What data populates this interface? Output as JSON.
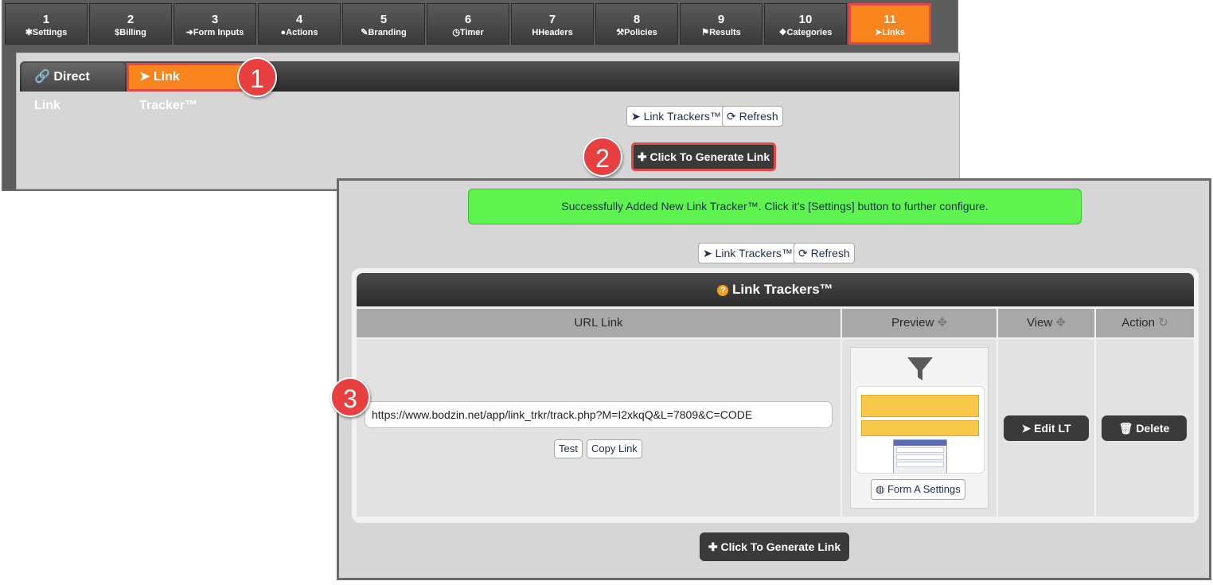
{
  "steps": [
    {
      "num": "1",
      "label": "Settings",
      "icon": "gear-icon"
    },
    {
      "num": "2",
      "label": "Billing",
      "icon": "dollar-icon"
    },
    {
      "num": "3",
      "label": "Form Inputs",
      "icon": "sign-in-icon"
    },
    {
      "num": "4",
      "label": "Actions",
      "icon": "user-icon"
    },
    {
      "num": "5",
      "label": "Branding",
      "icon": "brush-icon"
    },
    {
      "num": "6",
      "label": "Timer",
      "icon": "clock-icon"
    },
    {
      "num": "7",
      "label": "Headers",
      "icon": "header-icon"
    },
    {
      "num": "8",
      "label": "Policies",
      "icon": "gavel-icon"
    },
    {
      "num": "9",
      "label": "Results",
      "icon": "flag-icon"
    },
    {
      "num": "10",
      "label": "Categories",
      "icon": "cubes-icon"
    },
    {
      "num": "11",
      "label": "Links",
      "icon": "pointer-icon"
    }
  ],
  "active_step": "11",
  "subtabs": {
    "direct": "Direct Link",
    "tracker": "Link Tracker™"
  },
  "toolbar": {
    "link_trackers": "Link Trackers™",
    "refresh": "Refresh"
  },
  "generate_label": "Click To Generate Link",
  "annotations": {
    "one": "1",
    "two": "2",
    "three": "3"
  },
  "alert": "Successfully Added New Link Tracker™. Click it's [Settings] button to further configure.",
  "table": {
    "title": "Link Trackers™",
    "headers": {
      "url": "URL Link",
      "preview": "Preview",
      "view": "View",
      "action": "Action"
    },
    "row": {
      "url": "https://www.bodzin.net/app/link_trkr/track.php?M=I2xkqQ&L=7809&C=CODE",
      "test": "Test",
      "copy": "Copy Link",
      "preview_settings": "Form A Settings",
      "edit": "Edit LT",
      "delete": "Delete"
    }
  },
  "colors": {
    "accent": "#f7841c",
    "highlight": "#e24848",
    "success": "#5ef34f",
    "dark": "#3a3a3a"
  }
}
